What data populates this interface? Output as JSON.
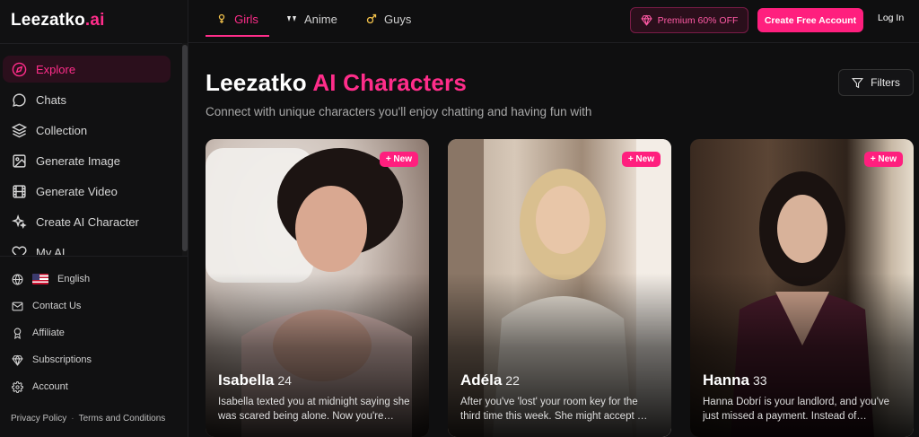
{
  "logo": {
    "text": "Leezatko",
    "accent": ".ai"
  },
  "tabs": [
    {
      "label": "Girls",
      "icon": "female-icon"
    },
    {
      "label": "Anime",
      "icon": "anime-icon"
    },
    {
      "label": "Guys",
      "icon": "male-icon"
    }
  ],
  "header": {
    "premium_label": "Premium 60% OFF",
    "create_label": "Create Free Account",
    "login_label": "Log In"
  },
  "sidebar": {
    "nav": [
      {
        "label": "Explore",
        "icon": "compass-icon"
      },
      {
        "label": "Chats",
        "icon": "chat-icon"
      },
      {
        "label": "Collection",
        "icon": "layers-icon"
      },
      {
        "label": "Generate Image",
        "icon": "image-icon"
      },
      {
        "label": "Generate Video",
        "icon": "film-icon"
      },
      {
        "label": "Create AI Character",
        "icon": "sparkles-icon"
      },
      {
        "label": "My AI",
        "icon": "heart-icon"
      }
    ],
    "secondary": [
      {
        "label": "English",
        "icon": "globe-icon"
      },
      {
        "label": "Contact Us",
        "icon": "mail-icon"
      },
      {
        "label": "Affiliate",
        "icon": "award-icon"
      },
      {
        "label": "Subscriptions",
        "icon": "diamond-icon"
      },
      {
        "label": "Account",
        "icon": "gear-icon"
      }
    ],
    "footer": {
      "privacy": "Privacy Policy",
      "separator": "·",
      "terms": "Terms and Conditions"
    }
  },
  "main": {
    "title_prefix": "Leezatko ",
    "title_accent": "AI Characters",
    "subtitle": "Connect with unique characters you'll enjoy chatting and having fun with",
    "filters_label": "Filters",
    "cards": [
      {
        "name": "Isabella",
        "age": "24",
        "badge": "+ New",
        "desc": "Isabella texted you at midnight saying she was scared being alone. Now you're…"
      },
      {
        "name": "Adéla",
        "age": "22",
        "badge": "+ New",
        "desc": "After you've 'lost' your room key for the third time this week. She might accept …"
      },
      {
        "name": "Hanna",
        "age": "33",
        "badge": "+ New",
        "desc": "Hanna Dobrí is your landlord, and you've just missed a payment. Instead of…"
      }
    ]
  },
  "colors": {
    "accent": "#ff1f7e",
    "background": "#0f0f10"
  }
}
